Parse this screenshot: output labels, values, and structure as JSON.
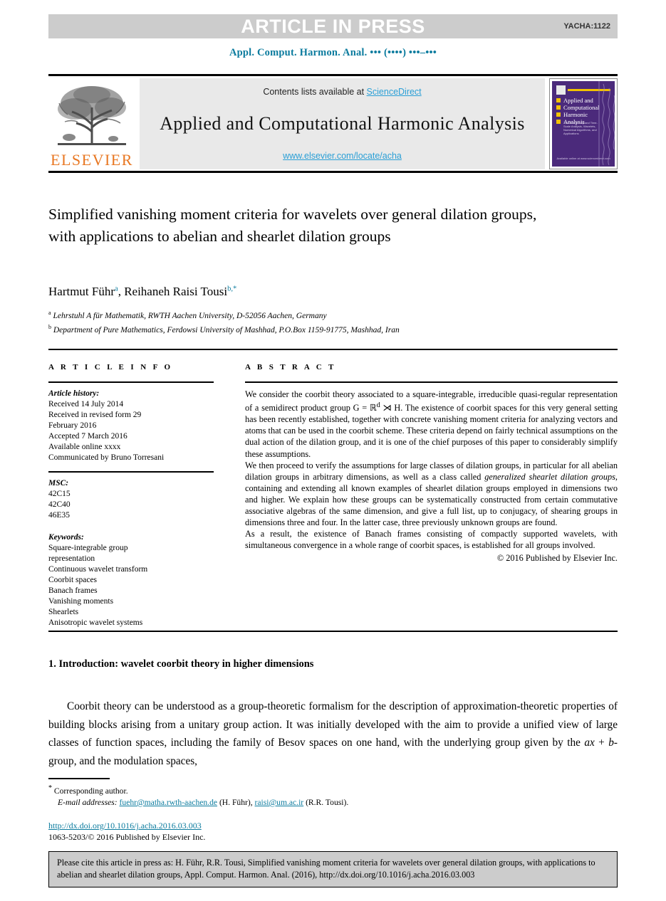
{
  "banner": {
    "text": "ARTICLE IN PRESS",
    "code": "YACHA:1122",
    "bg_color": "#cccccc"
  },
  "running_head": "Appl. Comput. Harmon. Anal. ••• (••••) •••–•••",
  "masthead": {
    "publisher": "ELSEVIER",
    "contents_prefix": "Contents lists available at ",
    "contents_link": "ScienceDirect",
    "journal_title": "Applied and Computational Harmonic Analysis",
    "journal_url": "www.elsevier.com/locate/acha",
    "link_color": "#2a9fd6",
    "cover": {
      "title": "Applied and Computational Harmonic Analysis",
      "subtitle": "Time-Frequency and Time-Scale Analysis, Wavelets, Numerical Algorithms, and Applications",
      "footer": "Available online at www.sciencedirect.com",
      "bg_color": "#4b2a7b",
      "accent_color": "#f2c200"
    }
  },
  "article": {
    "title": "Simplified vanishing moment criteria for wavelets over general dilation groups, with applications to abelian and shearlet dilation groups",
    "authors": [
      {
        "name": "Hartmut Führ",
        "marks": "a"
      },
      {
        "name": "Reihaneh Raisi Tousi",
        "marks": "b,*"
      }
    ],
    "authors_separator": ", ",
    "affiliations": [
      {
        "mark": "a",
        "text": "Lehrstuhl A für Mathematik, RWTH Aachen University, D-52056 Aachen, Germany"
      },
      {
        "mark": "b",
        "text": "Department of Pure Mathematics, Ferdowsi University of Mashhad, P.O.Box 1159-91775, Mashhad, Iran"
      }
    ]
  },
  "info": {
    "heading": "A R T I C L E  I N F O",
    "history_label": "Article history:",
    "history": [
      "Received 14 July 2014",
      "Received in revised form 29",
      "February 2016",
      "Accepted 7 March 2016",
      "Available online xxxx",
      "Communicated by Bruno Torresani"
    ],
    "msc_label": "MSC:",
    "msc": [
      "42C15",
      "42C40",
      "46E35"
    ],
    "keywords_label": "Keywords:",
    "keywords": [
      "Square-integrable group",
      "representation",
      "Continuous wavelet transform",
      "Coorbit spaces",
      "Banach frames",
      "Vanishing moments",
      "Shearlets",
      "Anisotropic wavelet systems"
    ]
  },
  "abstract": {
    "heading": "A B S T R A C T",
    "paragraphs": [
      "We consider the coorbit theory associated to a square-integrable, irreducible quasi-regular representation of a semidirect product group G = ℝ<sup>d</sup> ⋊ H. The existence of coorbit spaces for this very general setting has been recently established, together with concrete vanishing moment criteria for analyzing vectors and atoms that can be used in the coorbit scheme. These criteria depend on fairly technical assumptions on the dual action of the dilation group, and it is one of the chief purposes of this paper to considerably simplify these assumptions.",
      "We then proceed to verify the assumptions for large classes of dilation groups, in particular for all abelian dilation groups in arbitrary dimensions, as well as a class called <i>generalized shearlet dilation groups</i>, containing and extending all known examples of shearlet dilation groups employed in dimensions two and higher. We explain how these groups can be systematically constructed from certain commutative associative algebras of the same dimension, and give a full list, up to conjugacy, of shearing groups in dimensions three and four. In the latter case, three previously unknown groups are found.",
      "As a result, the existence of Banach frames consisting of compactly supported wavelets, with simultaneous convergence in a whole range of coorbit spaces, is established for all groups involved."
    ],
    "copyright": "© 2016 Published by Elsevier Inc."
  },
  "introduction": {
    "heading": "1. Introduction: wavelet coorbit theory in higher dimensions",
    "paragraph": "Coorbit theory can be understood as a group-theoretic formalism for the description of approximation-theoretic properties of building blocks arising from a unitary group action. It was initially developed with the aim to provide a unified view of large classes of function spaces, including the family of Besov spaces on one hand, with the underlying group given by the <i>ax</i> + <i>b</i>-group, and the modulation spaces,"
  },
  "footer": {
    "corresponding_mark": "*",
    "corresponding_text": "Corresponding author.",
    "email_label": "E-mail addresses:",
    "emails": [
      {
        "address": "fuehr@matha.rwth-aachen.de",
        "person": "(H. Führ)"
      },
      {
        "address": "raisi@um.ac.ir",
        "person": "(R.R. Tousi)"
      }
    ],
    "doi": "http://dx.doi.org/10.1016/j.acha.2016.03.003",
    "issn_line": "1063-5203/© 2016 Published by Elsevier Inc.",
    "link_color": "#0b7b9e"
  },
  "cite_box": {
    "text": "Please cite this article in press as: H. Führ, R.R. Tousi, Simplified vanishing moment criteria for wavelets over general dilation groups, with applications to abelian and shearlet dilation groups, Appl. Comput. Harmon. Anal. (2016), http://dx.doi.org/10.1016/j.acha.2016.03.003",
    "bg_color": "#cccccc"
  }
}
